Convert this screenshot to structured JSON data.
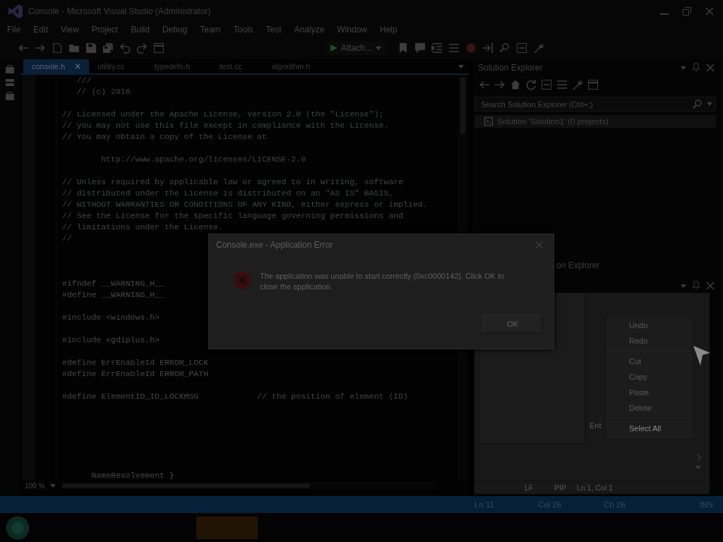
{
  "window": {
    "title": "Console - Microsoft Visual Studio (Administrator)"
  },
  "menu": [
    "File",
    "Edit",
    "View",
    "Project",
    "Build",
    "Debug",
    "Team",
    "Tools",
    "Test",
    "Analyze",
    "Window",
    "Help"
  ],
  "toolbar": {
    "run_button": "Attach..."
  },
  "editor": {
    "tabs": [
      {
        "label": "console.h",
        "selected": true
      },
      {
        "label": "utility.cc",
        "selected": false
      },
      {
        "label": "typedefs.h",
        "selected": false
      },
      {
        "label": "test.cc",
        "selected": false
      },
      {
        "label": "algorithm.h",
        "selected": false
      }
    ],
    "lines": [
      {
        "kind": "comment",
        "text": "   ///"
      },
      {
        "kind": "comment",
        "text": "   // (c) 2016"
      },
      {
        "kind": "blank"
      },
      {
        "kind": "comment",
        "text": "// Licensed under the Apache License, Version 2.0 (the \"License\");"
      },
      {
        "kind": "comment",
        "text": "// you may not use this file except in compliance with the License."
      },
      {
        "kind": "comment",
        "text": "// You may obtain a copy of the License at"
      },
      {
        "kind": "blank"
      },
      {
        "kind": "comment",
        "text": "        http://www.apache.org/licenses/LICENSE-2.0"
      },
      {
        "kind": "blank"
      },
      {
        "kind": "comment",
        "text": "// Unless required by applicable law or agreed to in writing, software"
      },
      {
        "kind": "comment",
        "text": "// distributed under the License is distributed on an \"AS IS\" BASIS,"
      },
      {
        "kind": "comment",
        "text": "// WITHOUT WARRANTIES OR CONDITIONS OF ANY KIND, either express or implied."
      },
      {
        "kind": "comment",
        "text": "// See the License for the specific language governing permissions and"
      },
      {
        "kind": "comment",
        "text": "// limitations under the License."
      },
      {
        "kind": "comment",
        "text": "//"
      },
      {
        "kind": "blank"
      },
      {
        "kind": "blank"
      },
      {
        "kind": "blank"
      },
      {
        "kind": "code",
        "text": "#ifndef __WARNING_H__"
      },
      {
        "kind": "code",
        "text": "#define __WARNING_H__"
      },
      {
        "kind": "blank"
      },
      {
        "kind": "code",
        "text": "#include <windows.h>"
      },
      {
        "kind": "blank"
      },
      {
        "kind": "code",
        "text": "#include <gdiplus.h>"
      },
      {
        "kind": "blank"
      },
      {
        "kind": "code",
        "text": "#define ErrEnableId ERROR_LOCK"
      },
      {
        "kind": "code",
        "text": "#define ErrEnableId ERROR_PATH"
      },
      {
        "kind": "blank"
      },
      {
        "kind": "code",
        "text": "#define ElementID_ID_LOCKMSG",
        "comment": "// the position of element (ID)"
      },
      {
        "kind": "blank"
      },
      {
        "kind": "blank"
      },
      {
        "kind": "blank"
      },
      {
        "kind": "blank"
      },
      {
        "kind": "blank"
      },
      {
        "kind": "blank"
      },
      {
        "kind": "code",
        "text": "      NameResolvement }"
      }
    ],
    "zoom": "100 %"
  },
  "solution_explorer": {
    "title": "Solution Explorer",
    "search": {
      "placeholder": "Search Solution Explorer (Ctrl+;)"
    },
    "items": [
      {
        "label": "Solution 'Solution1' (0 projects)",
        "selected": true
      }
    ],
    "tab": "on Explorer"
  },
  "text_panel": {
    "field_label": "Ent",
    "context_menu": {
      "groups": [
        {
          "items": [
            {
              "label": "Undo",
              "disabled": true
            },
            {
              "label": "Redo",
              "disabled": true
            }
          ]
        },
        {
          "items": [
            {
              "label": "Cut",
              "disabled": true
            },
            {
              "label": "Copy",
              "disabled": true
            },
            {
              "label": "Paste",
              "disabled": true
            },
            {
              "label": "Delete",
              "disabled": true
            }
          ]
        },
        {
          "items": [
            {
              "label": "Select All",
              "disabled": false
            }
          ]
        }
      ]
    },
    "status": [
      "LF",
      "PIP",
      "Ln 1, Col 1"
    ]
  },
  "dialog": {
    "title": "Console.exe - Application Error",
    "message": "The application was unable to start correctly (0xc0000142). Click OK to close the application.",
    "button": "OK"
  },
  "status_bar": [
    "Ln 11",
    "Col 26",
    "Ch 26",
    "INS"
  ]
}
